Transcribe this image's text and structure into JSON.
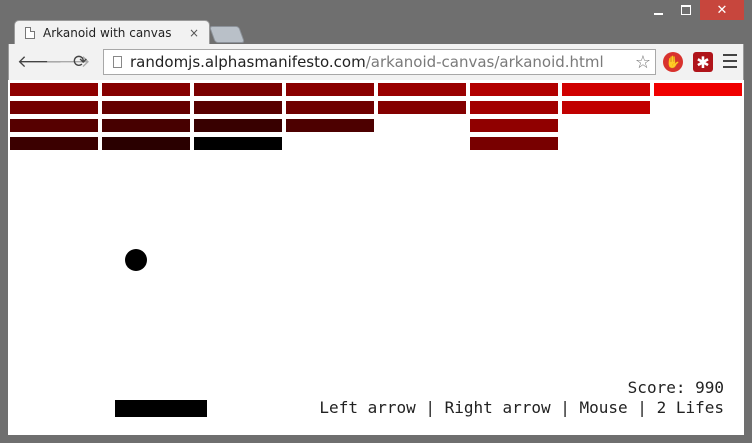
{
  "browser": {
    "tab_title": "Arkanoid with canvas",
    "tab_close": "×",
    "url_host": "randomjs.alphasmanifesto.com",
    "url_path": "/arkanoid-canvas/arkanoid.html",
    "icons": [
      "back-arrow-icon",
      "forward-arrow-icon",
      "reload-icon",
      "page-icon",
      "star-icon",
      "stop-extension-icon",
      "lastpass-extension-icon",
      "menu-icon"
    ]
  },
  "game": {
    "score_text": "Score: 990",
    "controls_text": "Left arrow | Right arrow | Mouse | 2 Lifes",
    "brick_rows": [
      [
        "#8e0000",
        "#860000",
        "#7a0000",
        "#8a0000",
        "#9a0000",
        "#b20000",
        "#d00000",
        "#f00000"
      ],
      [
        "#730000",
        "#650000",
        "#580000",
        "#6f0000",
        "#840000",
        "#a20000",
        "#c10000",
        null
      ],
      [
        "#560000",
        "#470000",
        "#380000",
        "#4d0000",
        null,
        "#900000",
        null,
        null
      ],
      [
        "#3b0000",
        "#2a0000",
        "#000000",
        null,
        null,
        "#780000",
        null,
        null
      ]
    ],
    "ball_color": "#000000",
    "paddle_color": "#000000"
  }
}
